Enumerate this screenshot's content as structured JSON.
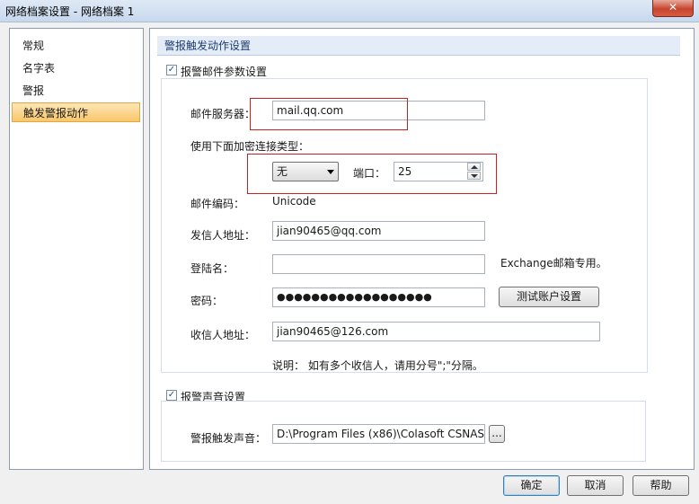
{
  "window": {
    "title": "网络档案设置 - 网络档案 1",
    "close": "✕"
  },
  "sidebar": {
    "items": [
      "常规",
      "名字表",
      "警报",
      "触发警报动作"
    ]
  },
  "section_title": "警报触发动作设置",
  "email": {
    "checkbox_label": "报警邮件参数设置",
    "checked": true,
    "server_label": "邮件服务器：",
    "server_value": "mail.qq.com",
    "encrypt_label": "使用下面加密连接类型：",
    "encrypt_value": "无",
    "port_label": "端口：",
    "port_value": "25",
    "encoding_label": "邮件编码：",
    "encoding_value": "Unicode",
    "sender_label": "发信人地址：",
    "sender_value": "jian90465@qq.com",
    "login_label": "登陆名：",
    "login_value": "",
    "login_note": "Exchange邮箱专用。",
    "password_label": "密码：",
    "password_value": "●●●●●●●●●●●●●●●●●●",
    "test_button": "测试账户设置",
    "recipient_label": "收信人地址：",
    "recipient_value": "jian90465@126.com",
    "note": "说明： 如有多个收信人，请用分号\";\"分隔。"
  },
  "sound": {
    "checkbox_label": "报警声音设置",
    "checked": true,
    "label": "警报触发声音：",
    "value": "D:\\Program Files (x86)\\Colasoft CSNAS",
    "browse": "..."
  },
  "footer": {
    "ok": "确定",
    "cancel": "取消",
    "help": "帮助"
  },
  "checkmark": "✓"
}
